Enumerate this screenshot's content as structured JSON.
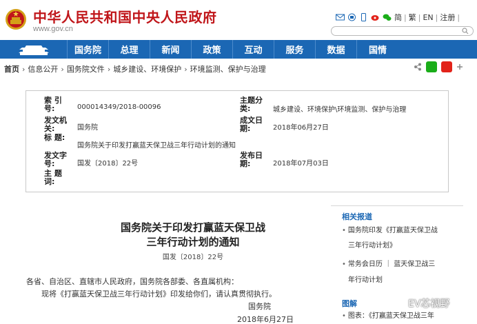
{
  "header": {
    "title": "中华人民共和国中央人民政府",
    "domain": "www.gov.cn",
    "links": {
      "trad": "繁",
      "en": "EN",
      "register": "注册"
    },
    "search_placeholder": ""
  },
  "nav": {
    "items": [
      "国务院",
      "总理",
      "新闻",
      "政策",
      "互动",
      "服务",
      "数据",
      "国情"
    ]
  },
  "breadcrumb": [
    "首页",
    "信息公开",
    "国务院文件",
    "城乡建设、环境保护",
    "环境监测、保护与治理"
  ],
  "info": {
    "index_label": "索 引 号:",
    "index_value": "000014349/2018-00096",
    "topic_label": "主题分类:",
    "topic_value": "城乡建设、环境保护\\环境监测、保护与治理",
    "issuer_label": "发文机关:",
    "issuer_value": "国务院",
    "date_label": "成文日期:",
    "date_value": "2018年06月27日",
    "title_label": "标 题:",
    "title_value": "国务院关于印发打赢蓝天保卫战三年行动计划的通知",
    "docno_label": "发文字号:",
    "docno_value": "国发〔2018〕22号",
    "pub_label": "发布日期:",
    "pub_value": "2018年07月03日",
    "subject_label": "主 题 词:"
  },
  "article": {
    "title_line1": "国务院关于印发打赢蓝天保卫战",
    "title_line2": "三年行动计划的通知",
    "doc_no": "国发〔2018〕22号",
    "para1": "各省、自治区、直辖市人民政府，国务院各部委、各直属机构：",
    "para2": "现将《打赢蓝天保卫战三年行动计划》印发给你们，请认真贯彻执行。",
    "sign": "国务院",
    "sign_date": "2018年6月27日"
  },
  "sidebar": {
    "related_heading": "相关报道",
    "related": [
      "国务院印发《打赢蓝天保卫战",
      "三年行动计划》",
      "常务会日历 ｜ 蓝天保卫战三",
      "年行动计划"
    ],
    "graphic_heading": "图解",
    "graphic": [
      "图表：《打赢蓝天保卫战三年"
    ]
  },
  "watermark": "EV芯视野",
  "colors": {
    "brand_red": "#c0161a",
    "nav_blue": "#1b67b4"
  }
}
